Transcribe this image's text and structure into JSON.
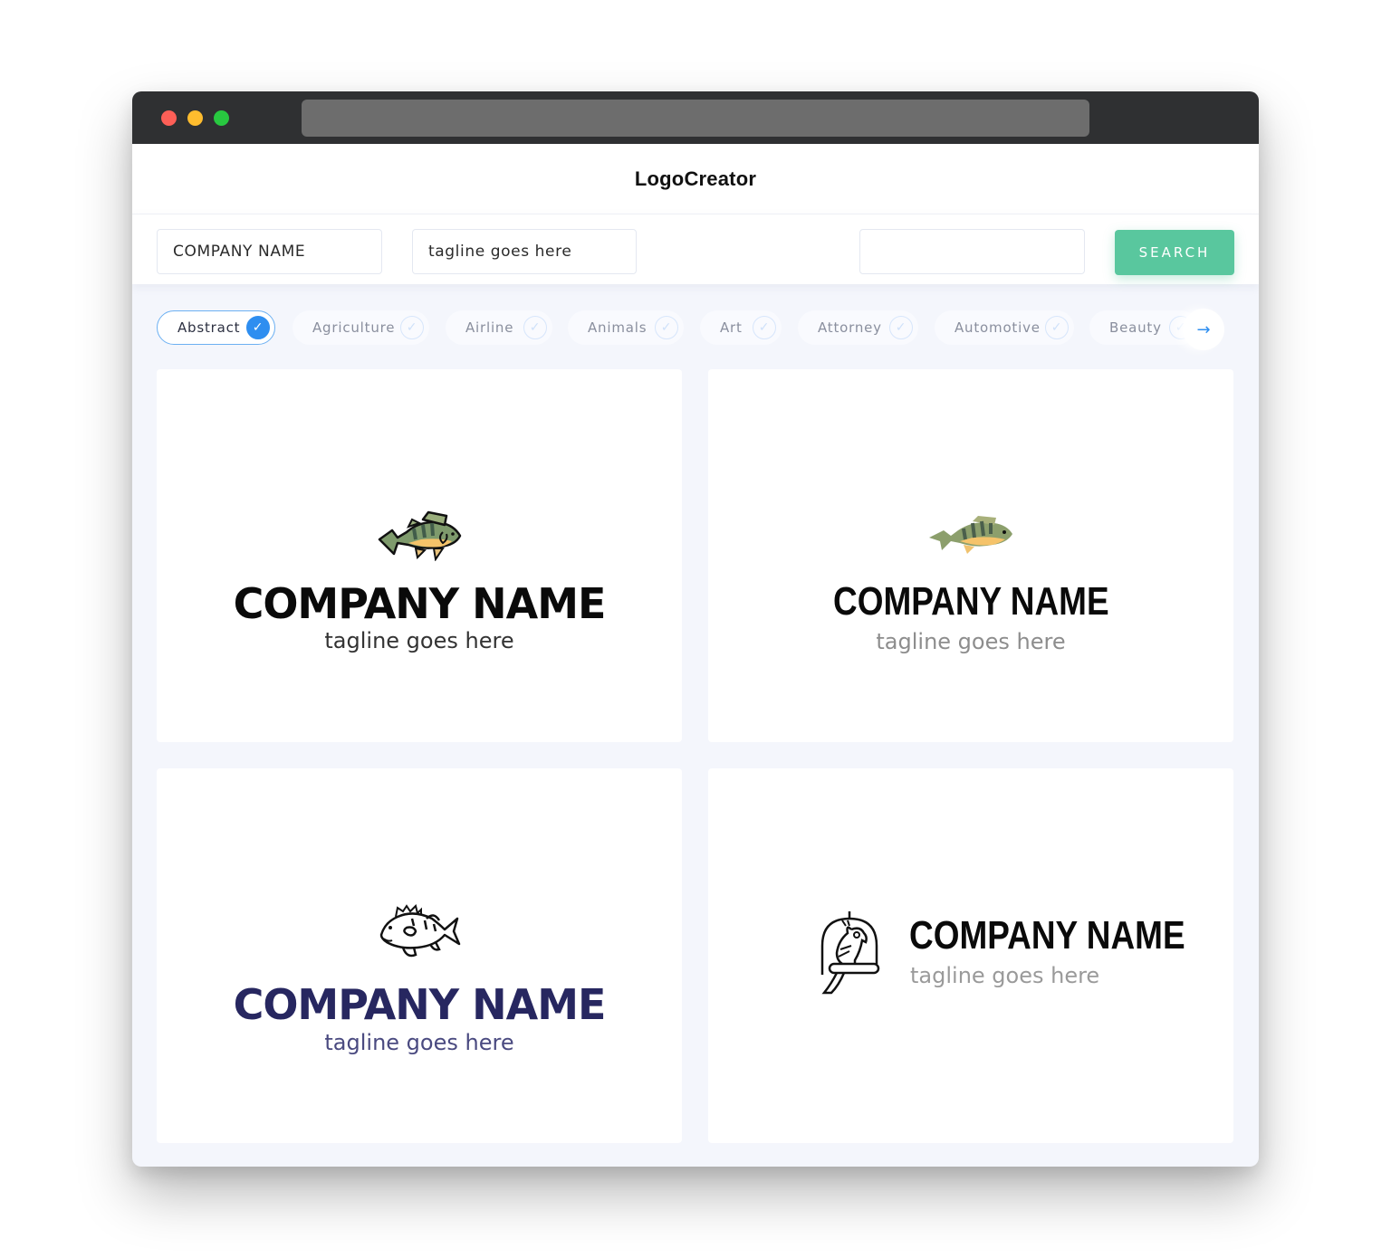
{
  "window": {
    "traffic_lights": [
      "close",
      "minimize",
      "maximize"
    ],
    "address_bar": ""
  },
  "header": {
    "brand": "LogoCreator"
  },
  "search": {
    "company_name_value": "COMPANY NAME",
    "tagline_value": "tagline goes here",
    "keyword_value": "",
    "button_label": "SEARCH"
  },
  "categories": {
    "items": [
      {
        "label": "Abstract",
        "selected": true
      },
      {
        "label": "Agriculture",
        "selected": false
      },
      {
        "label": "Airline",
        "selected": false
      },
      {
        "label": "Animals",
        "selected": false
      },
      {
        "label": "Art",
        "selected": false
      },
      {
        "label": "Attorney",
        "selected": false
      },
      {
        "label": "Automotive",
        "selected": false
      },
      {
        "label": "Beauty",
        "selected": false
      }
    ],
    "check_glyph": "✓",
    "next_glyph": "→"
  },
  "logos": [
    {
      "company": "COMPANY NAME",
      "tagline": "tagline goes here",
      "icon": "perch-fish-colored-outlined-icon",
      "name_color": "#0a0a0a",
      "tagline_color": "#333333"
    },
    {
      "company": "COMPANY NAME",
      "tagline": "tagline goes here",
      "icon": "perch-fish-flat-icon",
      "name_color": "#0a0a0a",
      "tagline_color": "#8d8d8d"
    },
    {
      "company": "COMPANY NAME",
      "tagline": "tagline goes here",
      "icon": "perch-fish-line-icon",
      "name_color": "#272760",
      "tagline_color": "#4a4a80"
    },
    {
      "company": "COMPANY NAME",
      "tagline": "tagline goes here",
      "icon": "parrot-in-cage-icon",
      "name_color": "#0a0a0a",
      "tagline_color": "#9a9a9a"
    }
  ],
  "colors": {
    "accent": "#2e8ef0",
    "search_button": "#59c79e",
    "titlebar": "#2f3032",
    "page_bg": "#f4f6fc"
  }
}
